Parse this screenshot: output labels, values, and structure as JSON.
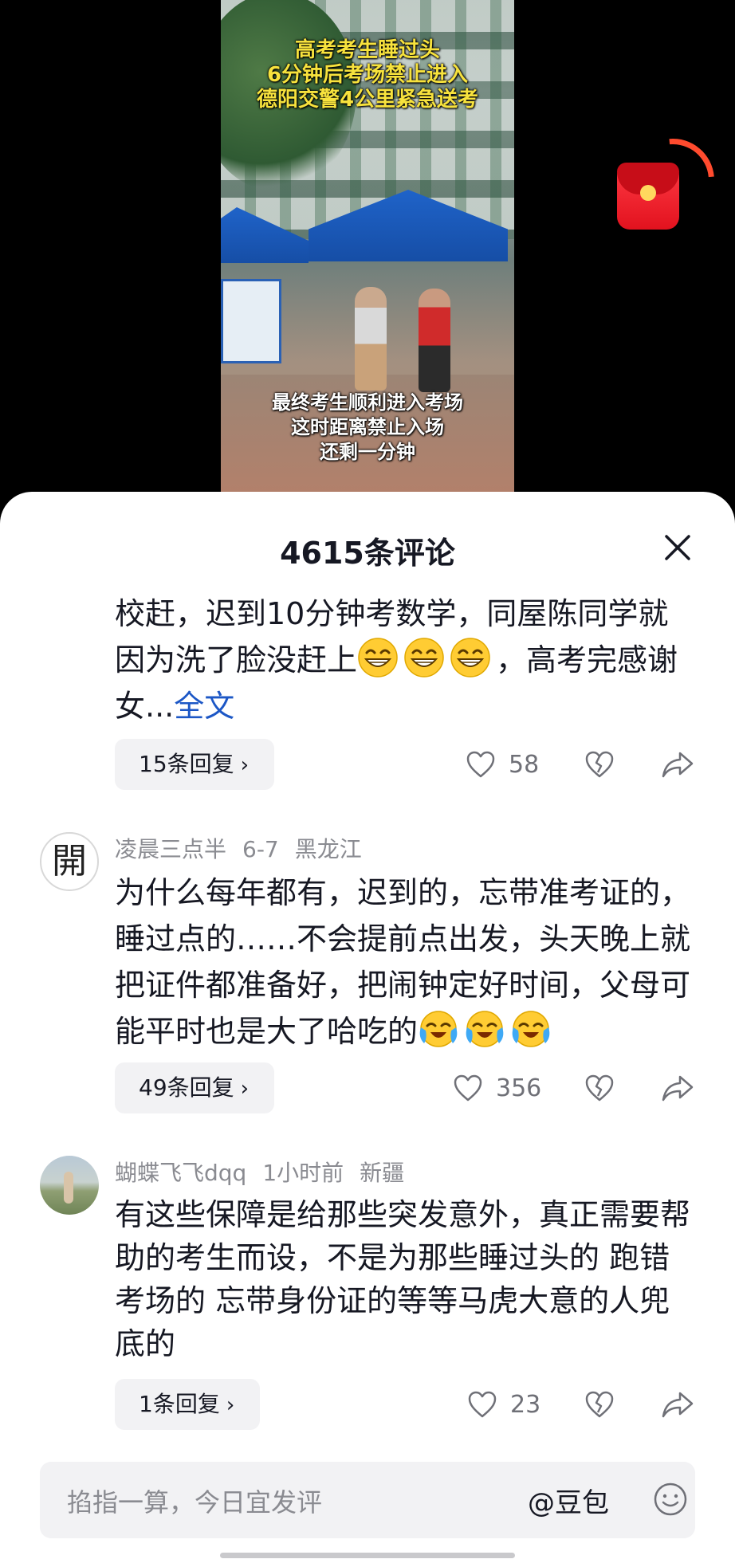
{
  "video": {
    "title_lines": [
      "高考考生睡过头",
      "6分钟后考场禁止进入",
      "德阳交警4公里紧急送考"
    ],
    "caption_lines": [
      "最终考生顺利进入考场",
      "这时距离禁止入场",
      "还剩一分钟"
    ],
    "colors": {
      "title": "#f7e23d",
      "caption": "#ffffff"
    }
  },
  "sheet": {
    "title": "4615条评论"
  },
  "comments": [
    {
      "text": "校赶，迟到10分钟考数学，同屋陈同学就因为洗了脸没赶上",
      "text_after_emoji": "，高考完感谢女...",
      "emoji": "grinning-face-emoji",
      "emoji_count": 3,
      "more_label": "全文",
      "replies_label": "15条回复",
      "likes": "58"
    },
    {
      "avatar_text": "開",
      "username": "凌晨三点半",
      "date": "6-7",
      "location": "黑龙江",
      "text": "为什么每年都有，迟到的，忘带准考证的，睡过点的……不会提前点出发，头天晚上就把证件都准备好，把闹钟定好时间，父母可能平时也是大了哈吃的",
      "emoji": "loudly-crying-face-emoji",
      "emoji_count": 3,
      "replies_label": "49条回复",
      "likes": "356"
    },
    {
      "username": "蝴蝶飞飞dqq",
      "date": "1小时前",
      "location": "新疆",
      "text": "有这些保障是给那些突发意外，真正需要帮助的考生而设，不是为那些睡过头的 跑错考场的 忘带身份证的等等马虎大意的人兜底的",
      "replies_label": "1条回复",
      "likes": "23"
    }
  ],
  "input": {
    "placeholder": "掐指一算，今日宜发评",
    "mention": "@豆包"
  },
  "colors": {
    "link": "#1c57c6",
    "text": "#161823",
    "muted": "#8a8b91",
    "envelope": "#e2121e"
  }
}
